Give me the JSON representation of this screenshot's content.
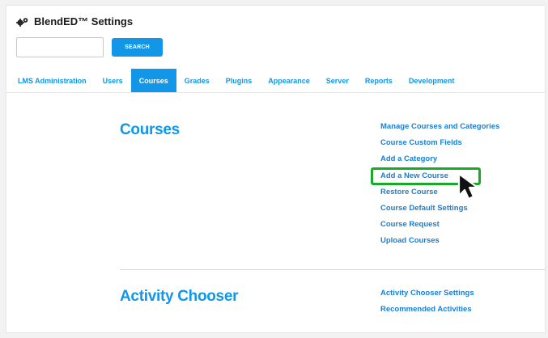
{
  "header": {
    "title": "BlendED™ Settings"
  },
  "search": {
    "placeholder": "",
    "button_label": "SEARCH"
  },
  "tabs": [
    {
      "label": "LMS Administration",
      "active": false
    },
    {
      "label": "Users",
      "active": false
    },
    {
      "label": "Courses",
      "active": true
    },
    {
      "label": "Grades",
      "active": false
    },
    {
      "label": "Plugins",
      "active": false
    },
    {
      "label": "Appearance",
      "active": false
    },
    {
      "label": "Server",
      "active": false
    },
    {
      "label": "Reports",
      "active": false
    },
    {
      "label": "Development",
      "active": false
    }
  ],
  "sections": [
    {
      "heading": "Courses",
      "links": [
        "Manage Courses and Categories",
        "Course Custom Fields",
        "Add a Category",
        "Add a New Course",
        "Restore Course",
        "Course Default Settings",
        "Course Request",
        "Upload Courses"
      ]
    },
    {
      "heading": "Activity Chooser",
      "links": [
        "Activity Chooser Settings",
        "Recommended Activities"
      ]
    }
  ],
  "highlighted_link": "Add a New Course",
  "colors": {
    "accent": "#1196e8",
    "link": "#1a7fd4",
    "highlight": "#1aa82a",
    "cursor": "#111111"
  },
  "icons": {
    "title": "gears-icon",
    "pointer": "cursor-arrow-icon"
  }
}
